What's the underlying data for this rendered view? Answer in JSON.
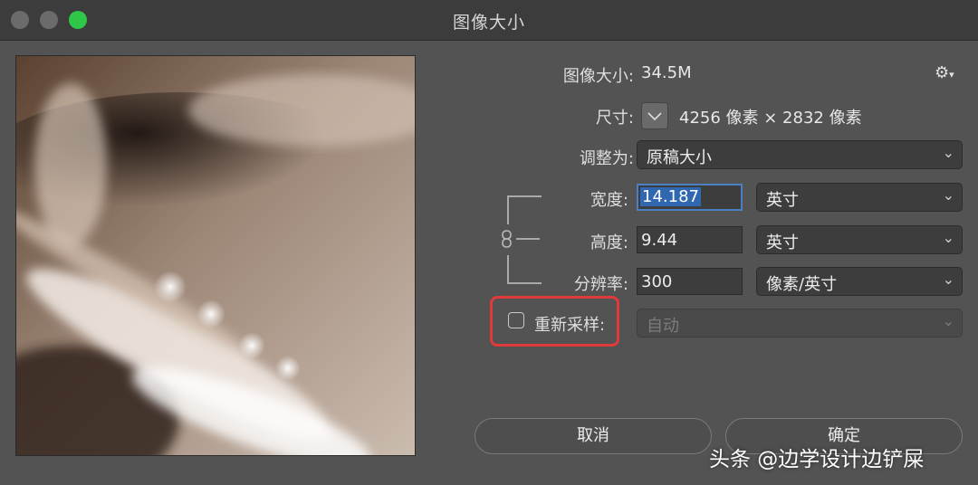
{
  "window": {
    "title": "图像大小"
  },
  "info": {
    "image_size_label": "图像大小:",
    "image_size_value": "34.5M",
    "dimensions_label": "尺寸:",
    "dimensions_value": "4256 像素  ×  2832 像素"
  },
  "fit_to": {
    "label": "调整为:",
    "value": "原稿大小"
  },
  "width": {
    "label": "宽度:",
    "value": "14.187",
    "unit": "英寸"
  },
  "height": {
    "label": "高度:",
    "value": "9.44",
    "unit": "英寸"
  },
  "resolution": {
    "label": "分辨率:",
    "value": "300",
    "unit": "像素/英寸"
  },
  "resample": {
    "label": "重新采样:",
    "checked": false,
    "method": "自动"
  },
  "buttons": {
    "cancel": "取消",
    "ok": "确定"
  },
  "watermark": "头条 @边学设计边铲屎",
  "colors": {
    "accent": "#2f67b0",
    "highlight_box": "#e03a3a",
    "zoom_button": "#2fc748"
  },
  "icons": {
    "settings": "gear-icon",
    "link": "chain-link-icon",
    "dropdown": "chevron-down-icon"
  }
}
